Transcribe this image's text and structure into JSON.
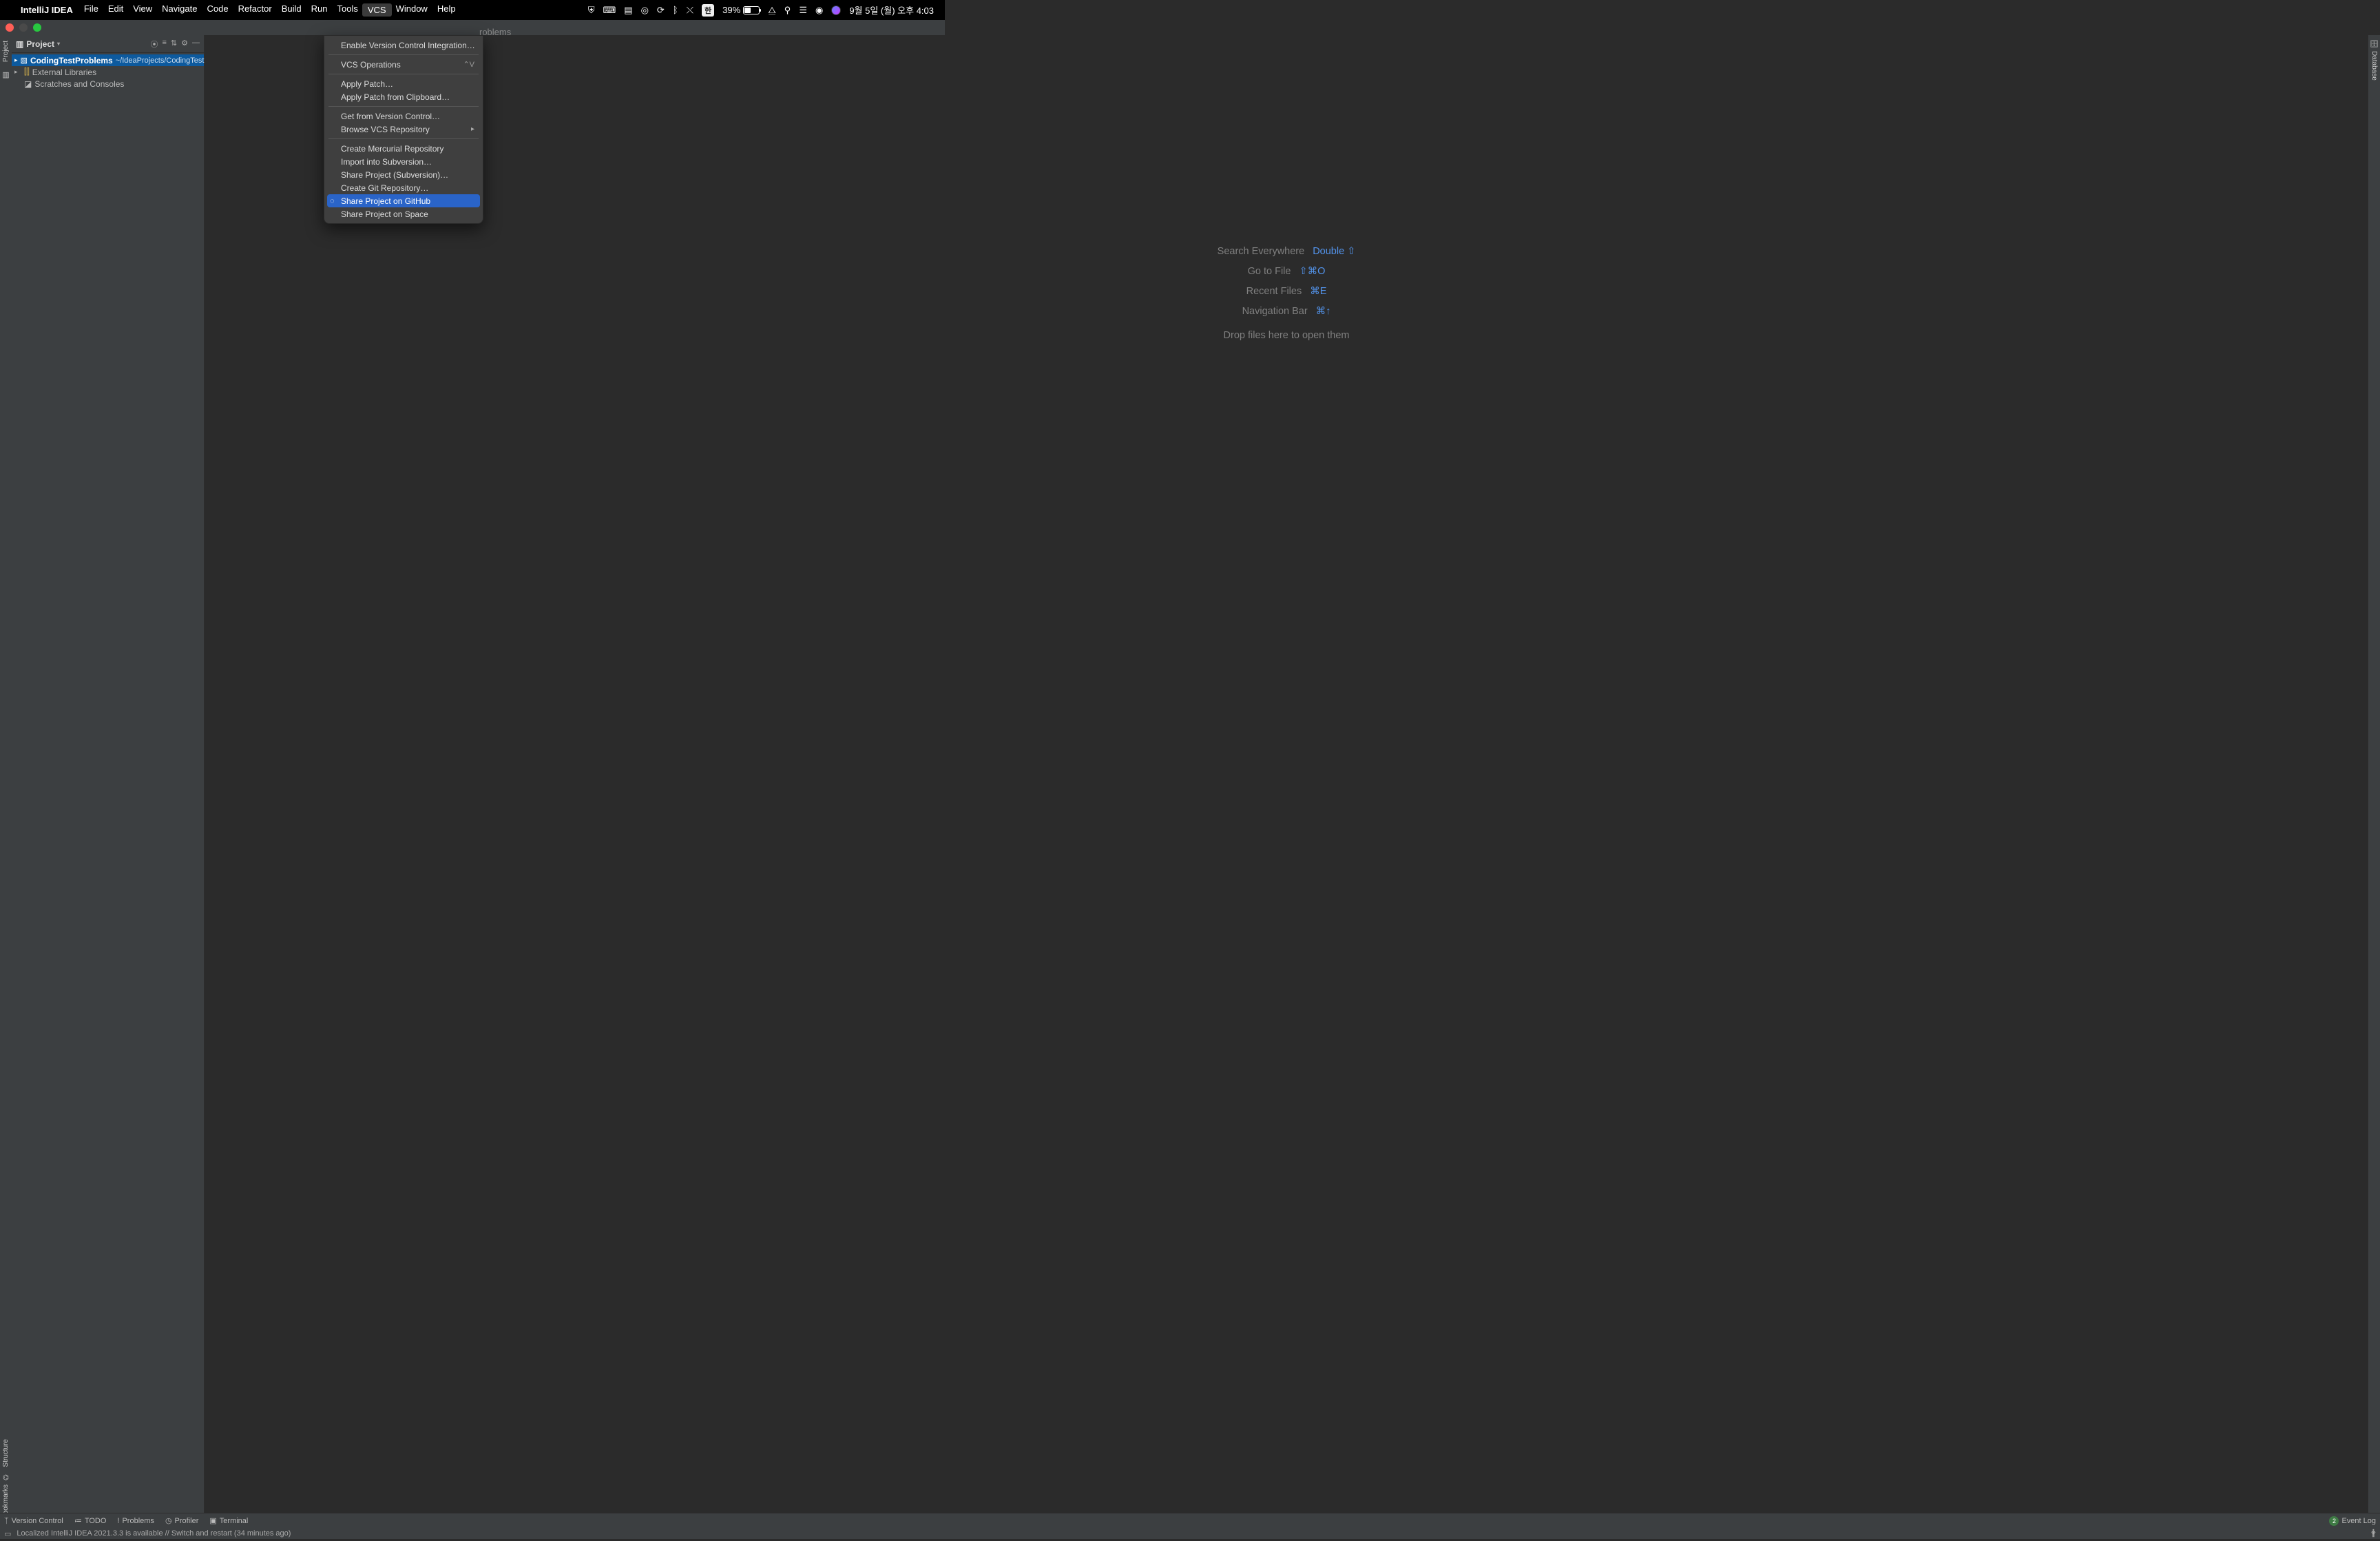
{
  "menubar": {
    "app": "IntelliJ IDEA",
    "items": [
      "File",
      "Edit",
      "View",
      "Navigate",
      "Code",
      "Refactor",
      "Build",
      "Run",
      "Tools",
      "VCS",
      "Window",
      "Help"
    ],
    "active_index": 9,
    "tray": {
      "ime": "한",
      "battery_pct": "39%",
      "datetime": "9월 5일 (월) 오후 4:03"
    }
  },
  "project": {
    "header_title": "Project",
    "root_name": "CodingTestProblems",
    "root_path": "~/IdeaProjects/CodingTest",
    "external_libs": "External Libraries",
    "scratches": "Scratches and Consoles"
  },
  "dropdown": {
    "groups": [
      [
        {
          "label": "Enable Version Control Integration…"
        }
      ],
      [
        {
          "label": "VCS Operations",
          "kbd": "⌃V"
        }
      ],
      [
        {
          "label": "Apply Patch…"
        },
        {
          "label": "Apply Patch from Clipboard…"
        }
      ],
      [
        {
          "label": "Get from Version Control…"
        },
        {
          "label": "Browse VCS Repository",
          "submenu": true
        }
      ],
      [
        {
          "label": "Create Mercurial Repository"
        },
        {
          "label": "Import into Subversion…"
        },
        {
          "label": "Share Project (Subversion)…"
        },
        {
          "label": "Create Git Repository…"
        },
        {
          "label": "Share Project on GitHub",
          "highlight": true,
          "icon": "github"
        },
        {
          "label": "Share Project on Space"
        }
      ]
    ]
  },
  "welcome": {
    "rows": [
      {
        "label": "Search Everywhere",
        "shortcut": "Double ⇧"
      },
      {
        "label": "Go to File",
        "shortcut": "⇧⌘O"
      },
      {
        "label": "Recent Files",
        "shortcut": "⌘E"
      },
      {
        "label": "Navigation Bar",
        "shortcut": "⌘↑"
      }
    ],
    "drop_hint": "Drop files here to open them"
  },
  "right_gutter_label": "Database",
  "left_gutter_label": "Project",
  "bottom_tools": {
    "version_control": "Version Control",
    "todo": "TODO",
    "problems": "Problems",
    "profiler": "Profiler",
    "terminal": "Terminal",
    "event_log": "Event Log",
    "event_badge": "2"
  },
  "status": {
    "message": "Localized IntelliJ IDEA 2021.3.3 is available // Switch and restart (34 minutes ago)"
  },
  "leaked_tab": "roblems"
}
